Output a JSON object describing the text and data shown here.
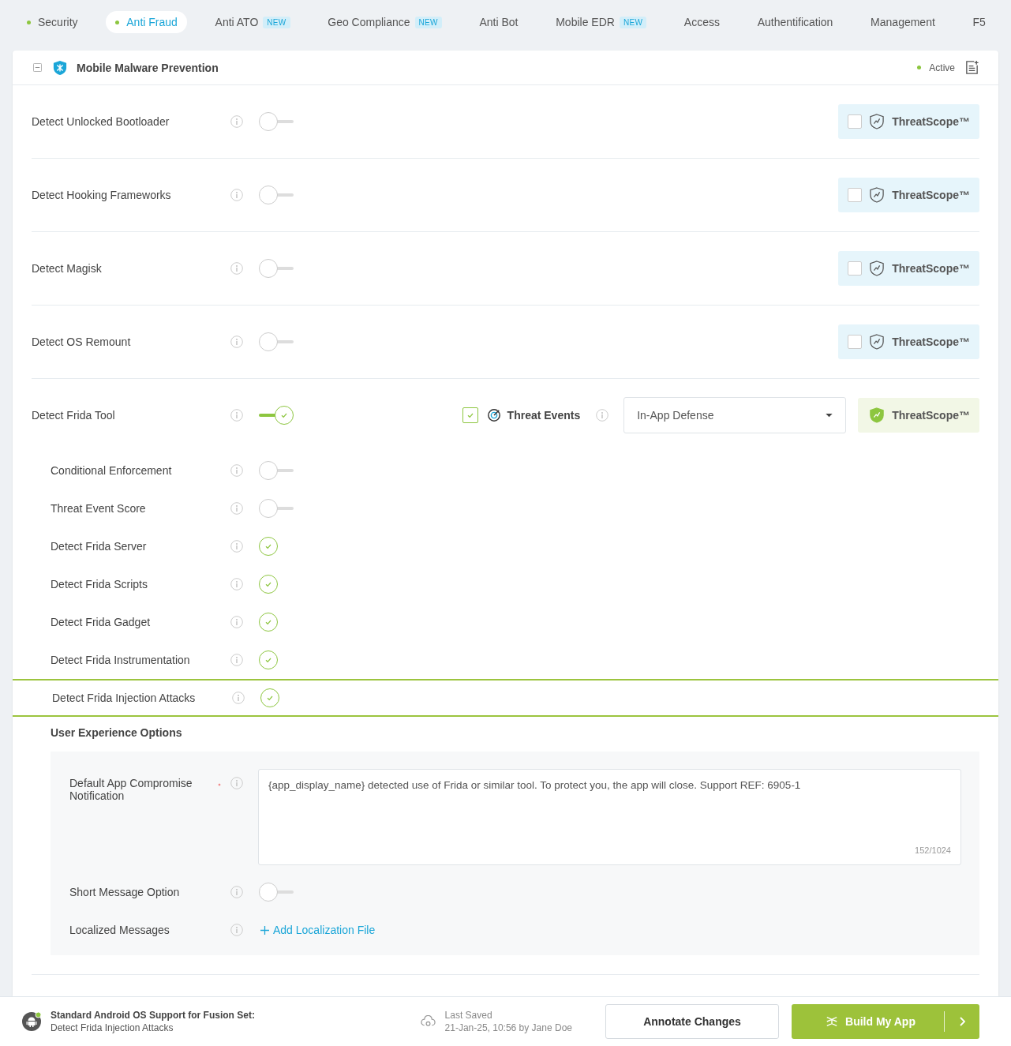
{
  "tabs": [
    {
      "label": "Security",
      "selected": false,
      "dot": true
    },
    {
      "label": "Anti Fraud",
      "selected": true,
      "dot": true
    },
    {
      "label": "Anti ATO",
      "selected": false,
      "badge": "NEW"
    },
    {
      "label": "Geo Compliance",
      "selected": false,
      "badge": "NEW"
    },
    {
      "label": "Anti Bot",
      "selected": false
    },
    {
      "label": "Mobile EDR",
      "selected": false,
      "badge": "NEW"
    },
    {
      "label": "Access",
      "selected": false
    },
    {
      "label": "Authentification",
      "selected": false
    },
    {
      "label": "Management",
      "selected": false
    },
    {
      "label": "F5",
      "selected": false
    }
  ],
  "section": {
    "title": "Mobile Malware Prevention",
    "expanded": true,
    "status": "Active"
  },
  "features": [
    {
      "label": "Detect Unlocked Bootloader",
      "on": false,
      "threatscope": {
        "label": "ThreatScope™",
        "checked": false
      }
    },
    {
      "label": "Detect Hooking Frameworks",
      "on": false,
      "threatscope": {
        "label": "ThreatScope™",
        "checked": false
      }
    },
    {
      "label": "Detect Magisk",
      "on": false,
      "threatscope": {
        "label": "ThreatScope™",
        "checked": false
      }
    },
    {
      "label": "Detect OS Remount",
      "on": false,
      "threatscope": {
        "label": "ThreatScope™",
        "checked": false
      }
    },
    {
      "label": "Detect Frida Tool",
      "on": true,
      "threat_events": {
        "label": "Threat Events",
        "checked": true
      },
      "response": "In-App Defense",
      "threatscope": {
        "label": "ThreatScope™",
        "checked": true
      }
    }
  ],
  "sub_options": [
    {
      "label": "Conditional Enforcement",
      "kind": "toggle",
      "on": false,
      "selected": false
    },
    {
      "label": "Threat Event Score",
      "kind": "toggle",
      "on": false,
      "selected": false
    },
    {
      "label": "Detect Frida Server",
      "kind": "check",
      "on": true,
      "selected": false
    },
    {
      "label": "Detect Frida Scripts",
      "kind": "check",
      "on": true,
      "selected": false
    },
    {
      "label": "Detect Frida Gadget",
      "kind": "check",
      "on": true,
      "selected": false
    },
    {
      "label": "Detect Frida Instrumentation",
      "kind": "check",
      "on": true,
      "selected": false
    },
    {
      "label": "Detect Frida Injection Attacks",
      "kind": "check",
      "on": true,
      "selected": true
    }
  ],
  "ux": {
    "title": "User Experience Options",
    "fields": [
      {
        "kind": "textarea",
        "label": "Default App Compromise Notification",
        "required": true,
        "value": "{app_display_name} detected use of Frida or similar tool. To protect you, the app will close. Support REF: 6905-1",
        "counter": "152/1024"
      },
      {
        "kind": "toggle",
        "label": "Short Message Option",
        "on": false
      },
      {
        "kind": "link",
        "label": "Localized Messages",
        "link": "Add Localization File"
      }
    ]
  },
  "footer": {
    "title": "Standard Android OS Support for Fusion Set:",
    "subtitle": "Detect Frida Injection Attacks",
    "online": true,
    "saved_label": "Last Saved",
    "saved_value": "21-Jan-25, 10:56 by Jane Doe",
    "annotate": "Annotate Changes",
    "build": "Build My App"
  }
}
